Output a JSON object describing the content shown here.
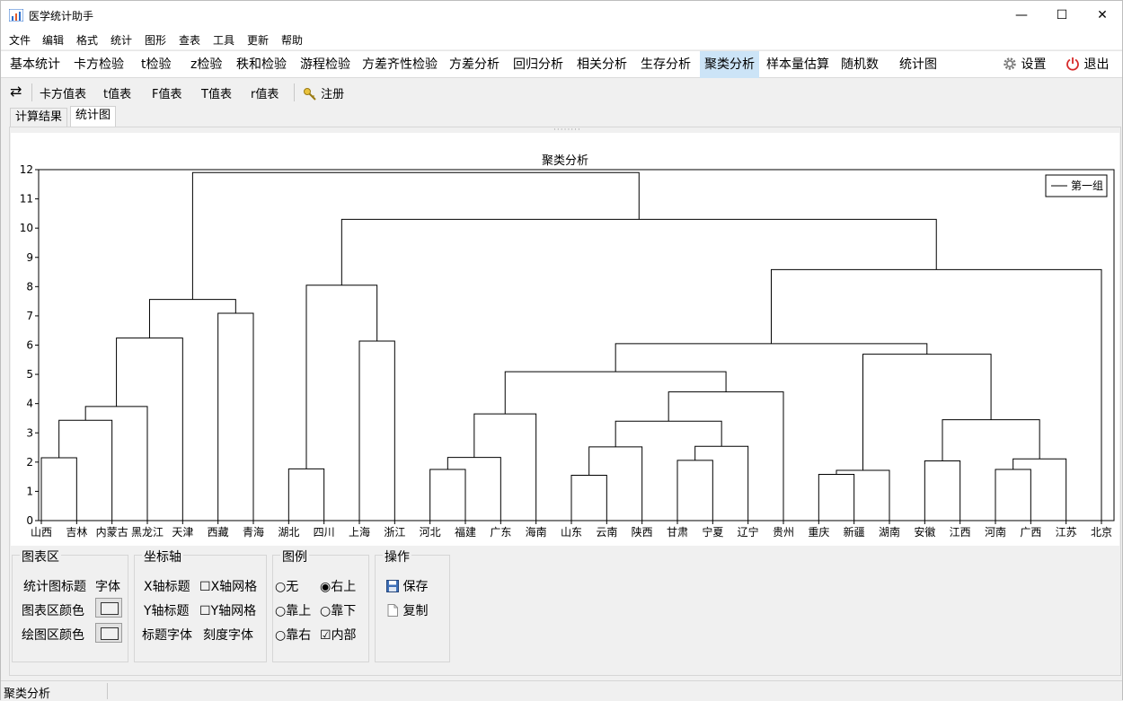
{
  "window": {
    "title": "医学统计助手",
    "minimize": "—",
    "maximize": "☐",
    "close": "✕"
  },
  "menus": [
    "文件",
    "编辑",
    "格式",
    "统计",
    "图形",
    "查表",
    "工具",
    "更新",
    "帮助"
  ],
  "tabs": [
    "基本统计",
    "卡方检验",
    "t检验",
    "z检验",
    "秩和检验",
    "游程检验",
    "方差齐性检验",
    "方差分析",
    "回归分析",
    "相关分析",
    "生存分析",
    "聚类分析",
    "样本量估算",
    "随机数",
    "统计图"
  ],
  "active_tab": "聚类分析",
  "right_buttons": {
    "settings": "设置",
    "exit": "退出"
  },
  "toolbar": {
    "items": [
      "卡方值表",
      "t值表",
      "F值表",
      "T值表",
      "r值表"
    ],
    "register": "注册"
  },
  "panel_tabs": [
    "计算结果",
    "统计图"
  ],
  "chart_data": {
    "type": "dendrogram",
    "title": "聚类分析",
    "ylim": [
      0,
      12
    ],
    "yticks": [
      0,
      1,
      2,
      3,
      4,
      5,
      6,
      7,
      8,
      9,
      10,
      11,
      12
    ],
    "leaves": [
      "山西",
      "吉林",
      "内蒙古",
      "黑龙江",
      "天津",
      "西藏",
      "青海",
      "湖北",
      "四川",
      "上海",
      "浙江",
      "河北",
      "福建",
      "广东",
      "海南",
      "山东",
      "云南",
      "陕西",
      "甘肃",
      "宁夏",
      "辽宁",
      "贵州",
      "重庆",
      "新疆",
      "湖南",
      "安徽",
      "江西",
      "河南",
      "广西",
      "江苏",
      "北京"
    ],
    "merges": [
      {
        "a": "L0",
        "b": "L1",
        "h": 2.15
      },
      {
        "a": "N0",
        "b": "L2",
        "h": 3.43
      },
      {
        "a": "N1",
        "b": "L3",
        "h": 3.9
      },
      {
        "a": "N2",
        "b": "L4",
        "h": 6.24
      },
      {
        "a": "L5",
        "b": "L6",
        "h": 7.09
      },
      {
        "a": "N3",
        "b": "N4",
        "h": 7.56
      },
      {
        "a": "L7",
        "b": "L8",
        "h": 1.77
      },
      {
        "a": "L9",
        "b": "L10",
        "h": 6.14
      },
      {
        "a": "N6",
        "b": "N7",
        "h": 8.05
      },
      {
        "a": "L11",
        "b": "L12",
        "h": 1.75
      },
      {
        "a": "N9",
        "b": "L13",
        "h": 2.16
      },
      {
        "a": "N10",
        "b": "L14",
        "h": 3.65
      },
      {
        "a": "L15",
        "b": "L16",
        "h": 1.55
      },
      {
        "a": "N12",
        "b": "L17",
        "h": 2.52
      },
      {
        "a": "L18",
        "b": "L19",
        "h": 2.06
      },
      {
        "a": "N14",
        "b": "L20",
        "h": 2.54
      },
      {
        "a": "N13",
        "b": "N15",
        "h": 3.4
      },
      {
        "a": "N16",
        "b": "L21",
        "h": 4.4
      },
      {
        "a": "N11",
        "b": "N17",
        "h": 5.09
      },
      {
        "a": "L22",
        "b": "L23",
        "h": 1.58
      },
      {
        "a": "N19",
        "b": "L24",
        "h": 1.72
      },
      {
        "a": "L25",
        "b": "L26",
        "h": 2.04
      },
      {
        "a": "L27",
        "b": "L28",
        "h": 1.75
      },
      {
        "a": "N22",
        "b": "L29",
        "h": 2.11
      },
      {
        "a": "N21",
        "b": "N23",
        "h": 3.45
      },
      {
        "a": "N20",
        "b": "N24",
        "h": 5.69
      },
      {
        "a": "N18",
        "b": "N25",
        "h": 6.05
      },
      {
        "a": "N26",
        "b": "L30",
        "h": 8.58
      },
      {
        "a": "N8",
        "b": "N27",
        "h": 10.3
      },
      {
        "a": "N5",
        "b": "N28",
        "h": 11.9
      }
    ],
    "legend": {
      "label": "第一组",
      "position": "top-right",
      "inside": true
    },
    "grid": false,
    "line_color": "#000000"
  },
  "groups": {
    "chart_area": {
      "title": "图表区",
      "chart_title_label": "统计图标题",
      "font": "字体",
      "chart_bg": "图表区颜色",
      "plot_bg": "绘图区颜色"
    },
    "axis": {
      "title": "坐标轴",
      "x_title": "X轴标题",
      "x_grid": "X轴网格",
      "y_title": "Y轴标题",
      "y_grid": "Y轴网格",
      "title_font": "标题字体",
      "tick_font": "刻度字体"
    },
    "legend": {
      "title": "图例",
      "none": "无",
      "top_right": "右上",
      "top": "靠上",
      "bottom": "靠下",
      "right": "靠右",
      "inside": "内部"
    },
    "ops": {
      "title": "操作",
      "save": "保存",
      "copy": "复制"
    }
  },
  "status": {
    "text": "聚类分析"
  }
}
